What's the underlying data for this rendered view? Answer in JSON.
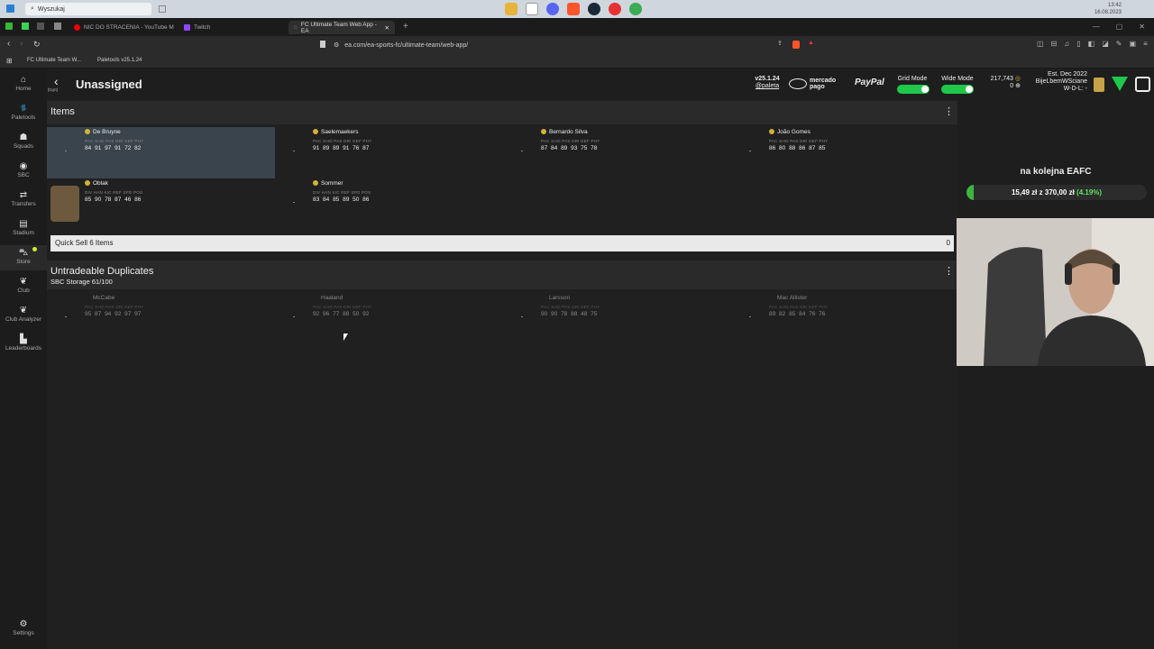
{
  "taskbar": {
    "search_placeholder": "Wyszukaj",
    "clock_time": "13:42",
    "clock_date": "16.08.2023"
  },
  "browser": {
    "tabs": [
      {
        "label": "NIC DO STRACENIA - YouTube M"
      },
      {
        "label": "Twitch"
      },
      {
        "label": "FC Ultimate Team Web App - EA"
      }
    ],
    "url": "ea.com/ea-sports-fc/ultimate-team/web-app/",
    "bookmarks": [
      "FC Ultimate Team W...",
      "Paletools v25.1.24"
    ]
  },
  "app": {
    "page_title": "Unassigned",
    "back_label": "[Dgrt]",
    "version": "v25.1.24",
    "author": "@paleta",
    "mercado_label": "mercado pago",
    "paypal_label": "PayPal",
    "grid_mode_label": "Grid Mode",
    "wide_mode_label": "Wide Mode",
    "coins": "217,743",
    "points": "0",
    "est_label": "Est. Dec 2022",
    "club_name": "BijeLbemWSciane",
    "record_label": "W-D-L: -",
    "accent_color": "#1fc84b"
  },
  "sidebar": {
    "items": [
      {
        "label": "Home"
      },
      {
        "label": "Paletools"
      },
      {
        "label": "Squads"
      },
      {
        "label": "SBC"
      },
      {
        "label": "Transfers"
      },
      {
        "label": "Stadium"
      },
      {
        "label": "Store"
      },
      {
        "label": "Club"
      },
      {
        "label": "Club Analyzer"
      },
      {
        "label": "Leaderboards"
      }
    ],
    "settings_label": "Settings"
  },
  "items_section": {
    "title": "Items",
    "outfield_headers": "PAC SHO PAS DRI DEF PHY",
    "gk_headers": "DIV HAN KIC REF SPD POS",
    "cards": [
      {
        "name": "De Bruyne",
        "values": "84 91 97 91 72 82"
      },
      {
        "name": "Saelemaekers",
        "values": "91 89 89 91 76 87"
      },
      {
        "name": "Bernardo Silva",
        "values": "87 84 89 93 75 78"
      },
      {
        "name": "João Gomes",
        "values": "86 80 88 86 87 85"
      },
      {
        "name": "Oblak",
        "values": "85 90 78 87 46 86"
      },
      {
        "name": "Sommer",
        "values": "83 84 85 89 50 86"
      }
    ]
  },
  "quick_sell": {
    "label": "Quick Sell 6 Items",
    "value": "0"
  },
  "duplicates_section": {
    "title": "Untradeable Duplicates",
    "subtitle": "SBC Storage 61/100",
    "cards": [
      {
        "name": "McCabe",
        "values": "95 87 94 92 97 97"
      },
      {
        "name": "Haaland",
        "values": "92 96 77 88 50 92"
      },
      {
        "name": "Larsson",
        "values": "90 90 78 88 48 75"
      },
      {
        "name": "Mac Allister",
        "values": "89 82 85 84 76 76"
      }
    ]
  },
  "stream": {
    "promo_title": "na kolejna EAFC",
    "progress_label_a": "15,49 zł",
    "progress_label_b": "z",
    "progress_label_c": "370,00 zł",
    "progress_percent": "(4.19%)",
    "progress_fraction": 0.0419
  }
}
